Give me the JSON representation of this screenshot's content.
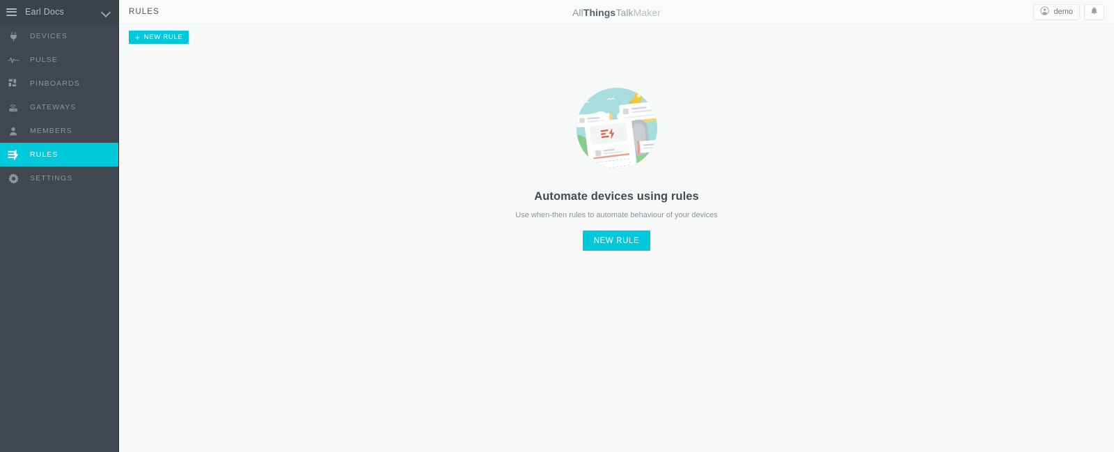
{
  "sidebar": {
    "menu_icon": "hamburger-icon",
    "workspace": "Earl Docs",
    "chevron_icon": "chevron-down-icon",
    "items": [
      {
        "label": "DEVICES",
        "icon": "plug-icon",
        "active": false
      },
      {
        "label": "PULSE",
        "icon": "pulse-icon",
        "active": false
      },
      {
        "label": "PINBOARDS",
        "icon": "grid-icon",
        "active": false
      },
      {
        "label": "GATEWAYS",
        "icon": "router-icon",
        "active": false
      },
      {
        "label": "MEMBERS",
        "icon": "person-icon",
        "active": false
      },
      {
        "label": "RULES",
        "icon": "rules-icon",
        "active": true
      },
      {
        "label": "SETTINGS",
        "icon": "gear-icon",
        "active": false
      }
    ]
  },
  "topbar": {
    "page_title": "RULES",
    "brand": {
      "part1": "All",
      "part2": "Things",
      "part3": "Talk",
      "part4": "Maker"
    },
    "user": {
      "name": "demo",
      "icon": "account-circle-icon"
    },
    "notifications": {
      "icon": "bell-icon"
    }
  },
  "toolbar": {
    "new_rule_label": "NEW RULE",
    "new_rule_plus": "+"
  },
  "empty_state": {
    "illustration": "rules-automation-illustration",
    "heading": "Automate devices using rules",
    "subtext": "Use when-then rules to automate behaviour of your devices",
    "cta_label": "NEW RULE"
  },
  "colors": {
    "accent": "#00c9dc",
    "sidebar_bg": "#3f474f",
    "sidebar_text": "#8d959c",
    "main_bg": "#f7f8f8",
    "heading": "#434b53"
  }
}
